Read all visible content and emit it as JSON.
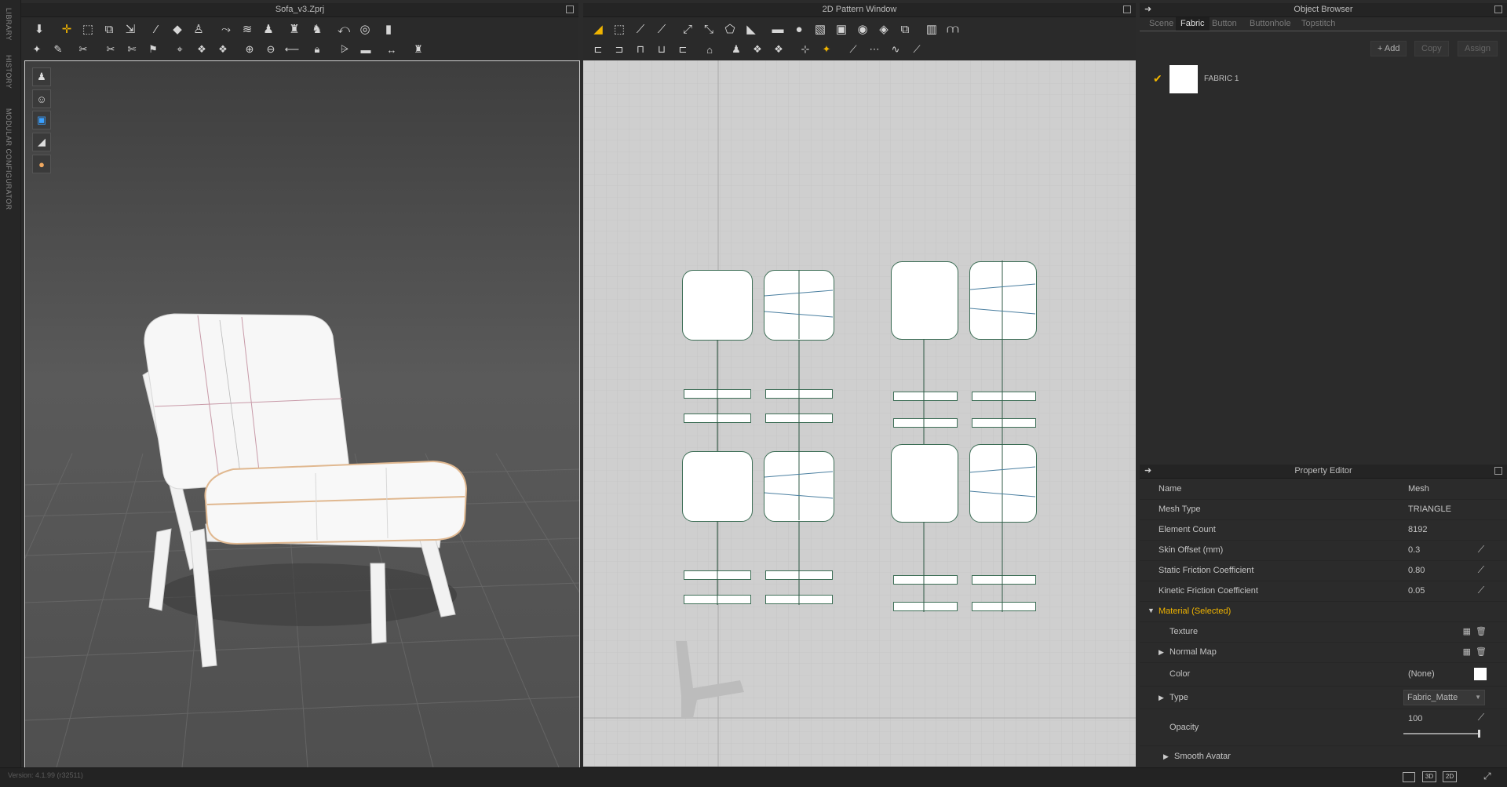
{
  "sidebar": {
    "tabs": [
      "LIBRARY",
      "HISTORY",
      "MODULAR CONFIGURATOR"
    ]
  },
  "viewport3d": {
    "title": "Sofa_v3.Zprj"
  },
  "pattern_window": {
    "title": "2D Pattern Window"
  },
  "object_browser": {
    "title": "Object Browser",
    "tabs": [
      {
        "label": "Scene"
      },
      {
        "label": "Fabric"
      },
      {
        "label": "Button"
      },
      {
        "label": "Buttonhole"
      },
      {
        "label": "Topstitch"
      }
    ],
    "buttons": {
      "add": "+ Add",
      "copy": "Copy",
      "assign": "Assign"
    },
    "items": [
      {
        "label": "FABRIC 1",
        "checked": true
      }
    ]
  },
  "property_editor": {
    "title": "Property Editor",
    "rows": [
      {
        "label": "Name",
        "value": "Mesh"
      },
      {
        "label": "Mesh Type",
        "value": "TRIANGLE"
      },
      {
        "label": "Element Count",
        "value": "8192"
      },
      {
        "label": "Skin Offset (mm)",
        "value": "0.3"
      },
      {
        "label": "Static Friction Coefficient",
        "value": "0.80"
      },
      {
        "label": "Kinetic Friction Coefficient",
        "value": "0.05"
      }
    ],
    "material_section": "Material (Selected)",
    "texture_label": "Texture",
    "normal_map_label": "Normal Map",
    "color_label": "Color",
    "color_value": "(None)",
    "type_label": "Type",
    "type_value": "Fabric_Matte",
    "opacity_label": "Opacity",
    "opacity_value": "100",
    "smooth_avatar_label": "Smooth Avatar"
  },
  "status": {
    "version": "Version: 4.1.99 (r32511)"
  },
  "colors": {
    "accent": "#f0b400",
    "panel_bg": "#2b2b2b",
    "pattern_stroke": "#3d6e56"
  }
}
